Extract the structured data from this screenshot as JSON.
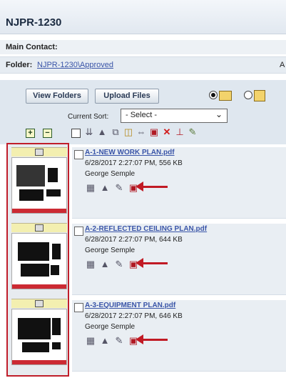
{
  "header": {
    "title": "NJPR-1230"
  },
  "contact": {
    "label": "Main Contact:"
  },
  "folder": {
    "label": "Folder:",
    "path": "NJPR-1230\\Approved",
    "overflow": "A"
  },
  "toolbar": {
    "view_folders": "View Folders",
    "upload_files": "Upload Files",
    "view_mode_selected": "thumbnail"
  },
  "sort": {
    "label": "Current Sort:",
    "value": "- Select -"
  },
  "files": [
    {
      "name": "A-1-NEW WORK PLAN.pdf",
      "meta": "6/28/2017 2:27:07 PM, 556 KB",
      "author": "George Semple"
    },
    {
      "name": "A-2-REFLECTED CEILING PLAN.pdf",
      "meta": "6/28/2017 2:27:07 PM, 644 KB",
      "author": "George Semple"
    },
    {
      "name": "A-3-EQUIPMENT PLAN.pdf",
      "meta": "6/28/2017 2:27:07 PM, 646 KB",
      "author": "George Semple"
    }
  ],
  "icons": {
    "toolbar": [
      "select-all-checkbox",
      "move-icon",
      "upload-stack-icon",
      "copy-icon",
      "folder-icon",
      "rename-icon",
      "lock-icon",
      "delete-icon",
      "stamp-icon",
      "edit-icon"
    ],
    "file_actions": [
      "preview-icon",
      "upload-stack-icon",
      "edit-icon",
      "lock-icon"
    ]
  },
  "colors": {
    "annotation_red": "#c01e2a",
    "link_blue": "#3a55a8"
  }
}
